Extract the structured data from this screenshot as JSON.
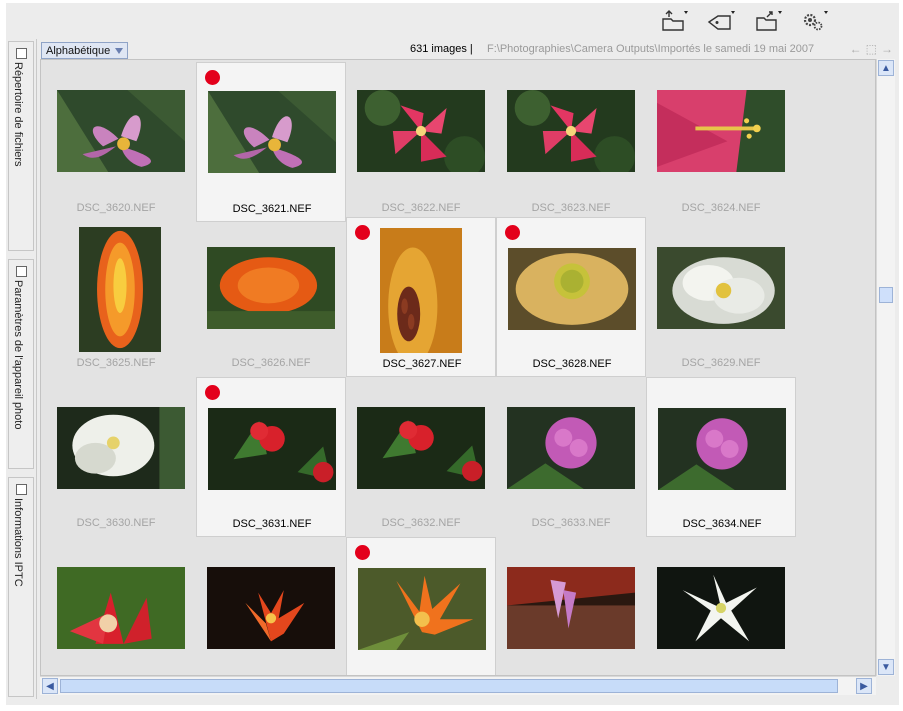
{
  "header": {
    "sort_label": "Alphabétique",
    "image_count": "631 images |",
    "folder_path": "F:\\Photographies\\Camera Outputs\\Importés le samedi 19 mai 2007",
    "nav_back": "←",
    "nav_folder": "⬚",
    "nav_forward": "→"
  },
  "toolbar": {
    "buttons": [
      "open-folder-icon",
      "tag-icon",
      "export-folder-icon",
      "settings-gears-icon"
    ]
  },
  "side_panels": [
    {
      "label": "Répertoire de fichiers"
    },
    {
      "label": "Paramètres de l'appareil photo"
    },
    {
      "label": "Informations IPTC"
    }
  ],
  "scroll": {
    "up": "▲",
    "down": "▼",
    "left": "◀",
    "right": "▶"
  },
  "thumbnails": [
    {
      "name": "DSC_3620.NEF",
      "selected": false,
      "marked": false
    },
    {
      "name": "DSC_3621.NEF",
      "selected": true,
      "marked": true
    },
    {
      "name": "DSC_3622.NEF",
      "selected": false,
      "marked": false
    },
    {
      "name": "DSC_3623.NEF",
      "selected": false,
      "marked": false
    },
    {
      "name": "DSC_3624.NEF",
      "selected": false,
      "marked": false
    },
    {
      "name": "DSC_3625.NEF",
      "selected": false,
      "marked": false
    },
    {
      "name": "DSC_3626.NEF",
      "selected": false,
      "marked": false
    },
    {
      "name": "DSC_3627.NEF",
      "selected": true,
      "marked": true
    },
    {
      "name": "DSC_3628.NEF",
      "selected": true,
      "marked": true
    },
    {
      "name": "DSC_3629.NEF",
      "selected": false,
      "marked": false
    },
    {
      "name": "DSC_3630.NEF",
      "selected": false,
      "marked": false
    },
    {
      "name": "DSC_3631.NEF",
      "selected": true,
      "marked": true
    },
    {
      "name": "DSC_3632.NEF",
      "selected": false,
      "marked": false
    },
    {
      "name": "DSC_3633.NEF",
      "selected": false,
      "marked": false
    },
    {
      "name": "DSC_3634.NEF",
      "selected": true,
      "marked": false
    },
    {
      "name": "",
      "selected": false,
      "marked": false
    },
    {
      "name": "",
      "selected": false,
      "marked": false
    },
    {
      "name": "",
      "selected": true,
      "marked": true
    },
    {
      "name": "",
      "selected": false,
      "marked": false
    },
    {
      "name": "",
      "selected": false,
      "marked": false
    }
  ],
  "colors": {
    "mark_dot": "#e3001b",
    "selection_bg": "#f4f4f4",
    "grid_bg": "#e3e3e3",
    "scroll_accent": "#c7dcf9"
  }
}
